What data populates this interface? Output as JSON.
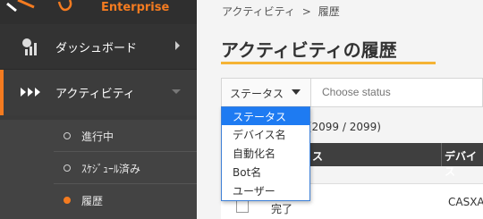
{
  "brand": {
    "name": "Enterprise"
  },
  "sidebar": {
    "items": [
      {
        "label": "ダッシュボード",
        "icon": "dashboard-icon"
      },
      {
        "label": "アクティビティ",
        "icon": "activity-icon"
      }
    ],
    "subitems": [
      {
        "label": "進行中"
      },
      {
        "label": "ｽｹｼﾞｭｰﾙ済み"
      },
      {
        "label": "履歴"
      }
    ]
  },
  "breadcrumb": {
    "root": "アクティビティ",
    "sep": ">",
    "current": "履歴"
  },
  "page": {
    "title": "アクティビティの履歴"
  },
  "filter": {
    "selected": "ステータス",
    "placeholder": "Choose status",
    "options": [
      "ステータス",
      "デバイス名",
      "自動化名",
      "Bot名",
      "ユーザー"
    ]
  },
  "results": {
    "label_tail": "ィ",
    "count": "(2099 / 2099)"
  },
  "table": {
    "headers": [
      "ス",
      "デバイス"
    ],
    "rows": [
      {
        "status": "完了",
        "device": "CASXAI"
      }
    ]
  },
  "colors": {
    "accent": "#f47b20",
    "selection": "#1e7bf2",
    "underline": "#f5b335"
  }
}
